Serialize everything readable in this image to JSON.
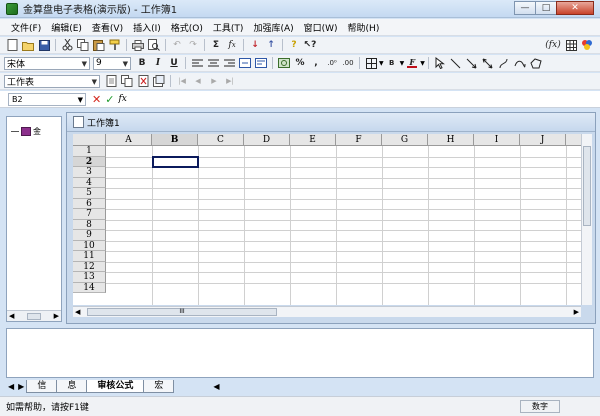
{
  "window": {
    "title": "金算盘电子表格(演示版) - 工作簿1",
    "controls": [
      "—",
      "□",
      "✕"
    ]
  },
  "menu": [
    "文件(F)",
    "编辑(E)",
    "查看(V)",
    "插入(I)",
    "格式(O)",
    "工具(T)",
    "加强库(A)",
    "窗口(W)",
    "帮助(H)"
  ],
  "toolbar2": {
    "font_name": "宋体",
    "font_size": "9",
    "bold": "B",
    "italic": "I",
    "underline": "U",
    "percent": "%",
    "comma": ","
  },
  "toolbar3": {
    "sheet_selector": "工作表"
  },
  "formula_bar": {
    "cell_ref": "B2",
    "cancel": "✕",
    "confirm": "✓",
    "fx": "fx"
  },
  "tree": {
    "root_label": "金"
  },
  "workbook": {
    "title": "工作簿1",
    "columns": [
      "A",
      "B",
      "C",
      "D",
      "E",
      "F",
      "G",
      "H",
      "I",
      "J"
    ],
    "rows": [
      "1",
      "2",
      "3",
      "4",
      "5",
      "6",
      "7",
      "8",
      "9",
      "10",
      "11",
      "12",
      "13",
      "14"
    ],
    "selected_column": "B",
    "selected_row": "2",
    "hscroll_grip": "III"
  },
  "sheet_tabs": [
    "信",
    "息",
    "审核公式",
    "宏"
  ],
  "status": {
    "message": "如需帮助，请按F1键",
    "mode": "数字"
  }
}
